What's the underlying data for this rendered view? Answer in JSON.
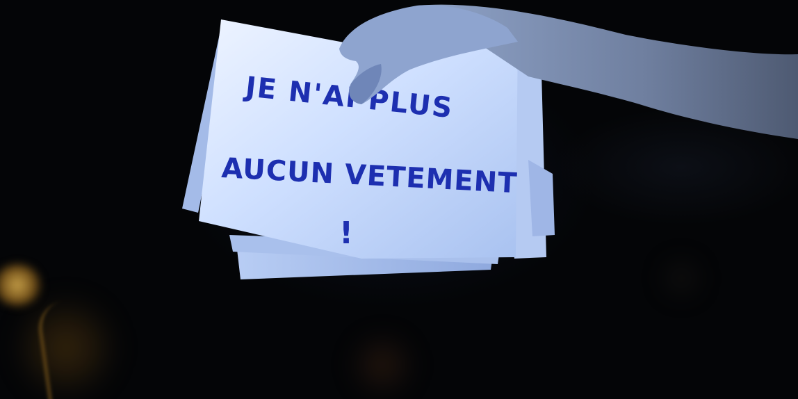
{
  "scene": {
    "description_alt": "",
    "sign": {
      "line1": "JE N'AI PLUS",
      "line2": "AUCUN VETEMENT",
      "line3": "!"
    },
    "colors": {
      "background": "#040507",
      "paper": "#d6e4ff",
      "ink": "#1d2fb0",
      "lamp": "#c9a24a"
    }
  }
}
